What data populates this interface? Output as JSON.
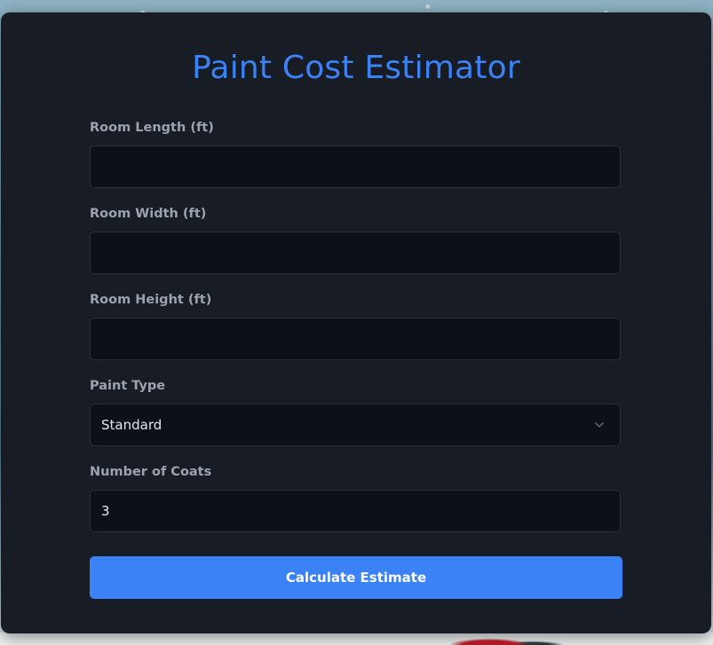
{
  "app": {
    "title": "Paint Cost Estimator"
  },
  "form": {
    "length": {
      "label": "Room Length (ft)",
      "value": ""
    },
    "width": {
      "label": "Room Width (ft)",
      "value": ""
    },
    "height": {
      "label": "Room Height (ft)",
      "value": ""
    },
    "paint_type": {
      "label": "Paint Type",
      "selected": "Standard"
    },
    "coats": {
      "label": "Number of Coats",
      "value": "3"
    },
    "submit_label": "Calculate Estimate"
  },
  "icons": {
    "select_chevron": "chevron-down-icon"
  },
  "colors": {
    "accent": "#3b82f6",
    "card_bg": "#181c24",
    "input_bg": "#0c1017",
    "label": "#9aa3b0"
  }
}
